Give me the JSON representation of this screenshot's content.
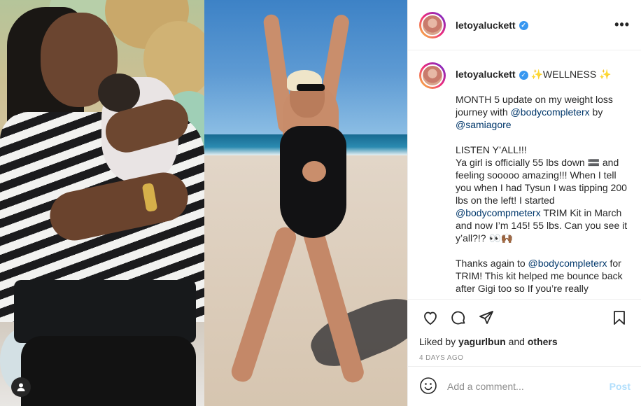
{
  "post": {
    "username": "letoyaluckett",
    "verified_mark": "✓",
    "more": "•••"
  },
  "caption": {
    "username": "letoyaluckett",
    "title": " ✨WELLNESS ✨",
    "p1_a": "MONTH 5 update on my weight loss journey with ",
    "p1_tag1": "@bodycompleterx",
    "p1_b": " by ",
    "p1_tag2": "@samiagore",
    "p2": "LISTEN Y’ALL!!!\nYa girl is officially 55 lbs down 🟰 and feeling sooooo amazing!!! When I tell you when I had Tysun I was tipping 200 lbs on the left! I started ",
    "p2_tag": "@bodycompmeterx",
    "p2_b": " TRIM Kit in March and now I’m 145! 55 lbs. Can you see it y’all?!? 👀🙌🏾",
    "p3_a": "Thanks again to ",
    "p3_tag": "@bodycompleterx",
    "p3_b": " for TRIM! This kit helped me bounce back after Gigi too so If you’re really"
  },
  "likes": {
    "prefix": "Liked by ",
    "user": "yagurlbun",
    "and": " and ",
    "others": "others"
  },
  "timestamp": "4 DAYS AGO",
  "comment": {
    "placeholder": "Add a comment...",
    "post_label": "Post"
  },
  "icons": {
    "like": "heart-icon",
    "comment": "comment-icon",
    "share": "share-icon",
    "save": "bookmark-icon",
    "emoji": "emoji-icon",
    "profile": "person-icon"
  },
  "colors": {
    "link": "#00376b",
    "verified": "#3897f0",
    "post_disabled": "#b2dffc",
    "muted": "#8e8e8e"
  }
}
